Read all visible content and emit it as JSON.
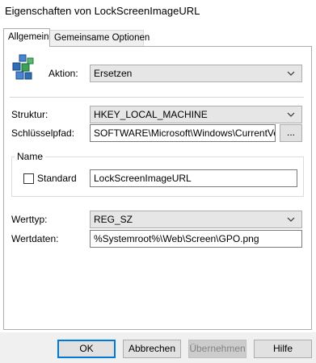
{
  "window": {
    "title": "Eigenschaften von LockScreenImageURL"
  },
  "tabs": [
    {
      "label": "Allgemein",
      "active": true
    },
    {
      "label": "Gemeinsame Optionen",
      "active": false
    }
  ],
  "general": {
    "icon": "registry-icon",
    "action_label": "Aktion:",
    "action_value": "Ersetzen",
    "hive_label": "Struktur:",
    "hive_value": "HKEY_LOCAL_MACHINE",
    "keypath_label": "Schlüsselpfad:",
    "keypath_value": "SOFTWARE\\Microsoft\\Windows\\CurrentVersio",
    "browse_label": "...",
    "name_group_label": "Name",
    "default_label": "Standard",
    "default_checked": false,
    "name_value": "LockScreenImageURL",
    "valuetype_label": "Werttyp:",
    "valuetype_value": "REG_SZ",
    "valuedata_label": "Wertdaten:",
    "valuedata_value": "%Systemroot%\\Web\\Screen\\GPO.png"
  },
  "buttons": {
    "ok": "OK",
    "cancel": "Abbrechen",
    "apply": "Übernehmen",
    "help": "Hilfe"
  },
  "colors": {
    "default_button_border": "#0078d7",
    "icon_blue": "#2e6fb8",
    "icon_green": "#3aa357"
  }
}
